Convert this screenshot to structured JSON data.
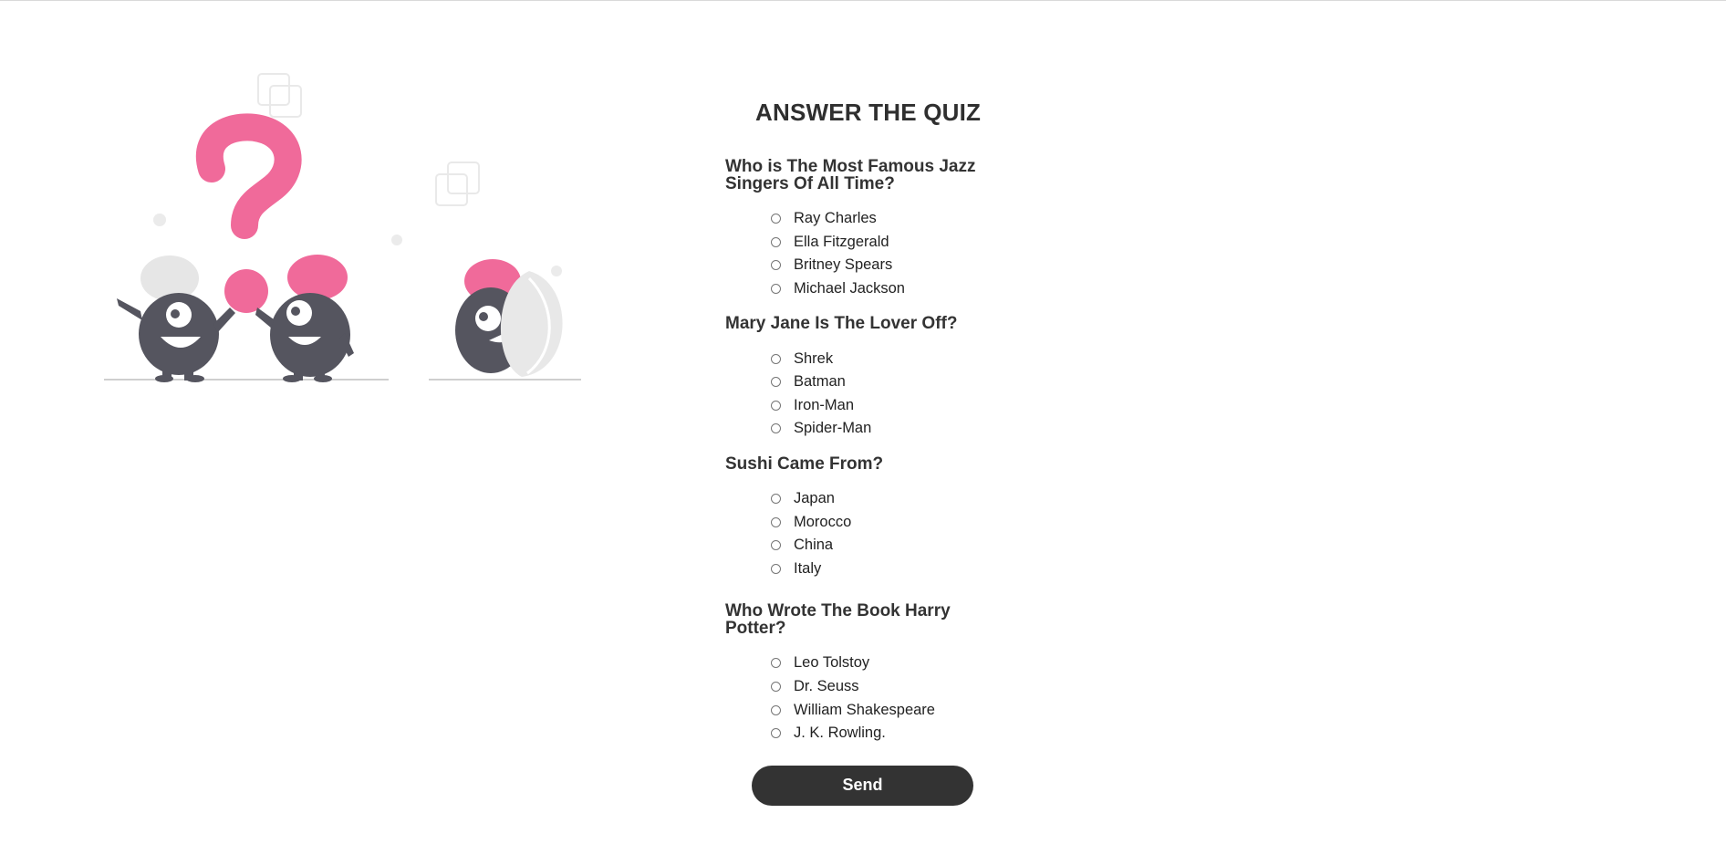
{
  "quiz": {
    "title": "ANSWER THE QUIZ",
    "questions": [
      {
        "text": "Who is The Most Famous Jazz Singers Of All Time?",
        "options": [
          "Ray Charles",
          "Ella Fitzgerald",
          "Britney Spears",
          "Michael Jackson"
        ]
      },
      {
        "text": "Mary Jane Is The Lover Off?",
        "options": [
          "Shrek",
          "Batman",
          "Iron-Man",
          "Spider-Man"
        ]
      },
      {
        "text": "Sushi Came From?",
        "options": [
          "Japan",
          "Morocco",
          "China",
          "Italy"
        ]
      },
      {
        "text": "Who Wrote The Book Harry Potter?",
        "options": [
          "Leo Tolstoy",
          "Dr. Seuss",
          "William Shakespeare",
          "J. K. Rowling."
        ]
      }
    ],
    "send_label": "Send"
  },
  "colors": {
    "accent_pink": "#f06a9a",
    "character_dark": "#55555f",
    "button_dark": "#333333",
    "light_gray": "#e6e6e6"
  }
}
